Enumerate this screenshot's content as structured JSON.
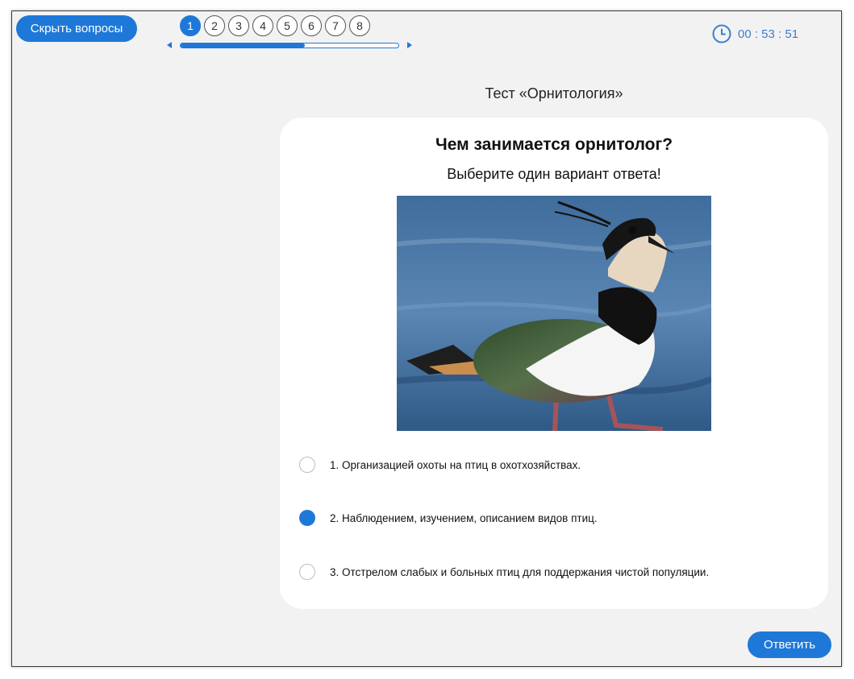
{
  "header": {
    "hide_questions_label": "Скрыть вопросы",
    "question_numbers": [
      "1",
      "2",
      "3",
      "4",
      "5",
      "6",
      "7",
      "8"
    ],
    "active_question": "1",
    "progress_fraction": 0.57,
    "timer": "00 : 53 : 51"
  },
  "test": {
    "title": "Тест «Орнитология»",
    "question": "Чем занимается орнитолог?",
    "instruction": "Выберите один вариант ответа!",
    "image_subject": "northern lapwing bird",
    "options": [
      {
        "label": "1. Организацией охоты на птиц в охотхозяйствах.",
        "selected": false
      },
      {
        "label": "2. Наблюдением, изучением, описанием видов птиц.",
        "selected": true
      },
      {
        "label": "3. Отстрелом слабых и больных птиц для поддержания чистой популяции.",
        "selected": false
      }
    ]
  },
  "footer": {
    "submit_label": "Ответить"
  },
  "colors": {
    "accent": "#1e78d8",
    "timer": "#3a7fd0",
    "page_bg": "#f2f2f2"
  }
}
